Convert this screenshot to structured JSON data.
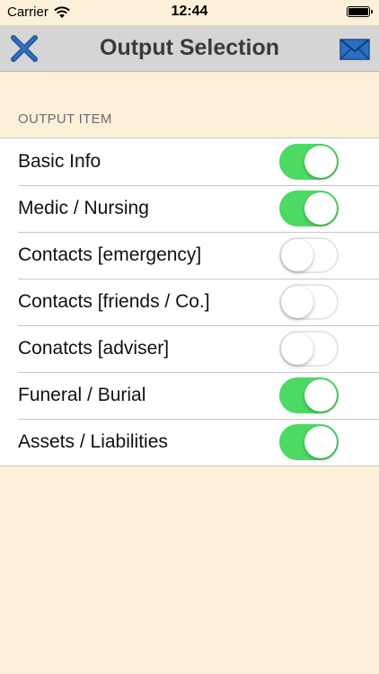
{
  "status_bar": {
    "carrier": "Carrier",
    "time": "12:44"
  },
  "nav": {
    "title": "Output Selection",
    "close_icon": "close-x-icon",
    "mail_icon": "mail-envelope-icon"
  },
  "section": {
    "header": "OUTPUT ITEM"
  },
  "items": [
    {
      "label": "Basic Info",
      "on": true
    },
    {
      "label": "Medic / Nursing",
      "on": true
    },
    {
      "label": "Contacts [emergency]",
      "on": false
    },
    {
      "label": "Contacts [friends / Co.]",
      "on": false
    },
    {
      "label": "Conatcts [adviser]",
      "on": false
    },
    {
      "label": "Funeral / Burial",
      "on": true
    },
    {
      "label": "Assets / Liabilities",
      "on": true
    }
  ],
  "colors": {
    "background": "#fdf0d8",
    "nav_background": "#d5d5d5",
    "toggle_on": "#4cd964",
    "icon_blue": "#1f5aa6"
  }
}
